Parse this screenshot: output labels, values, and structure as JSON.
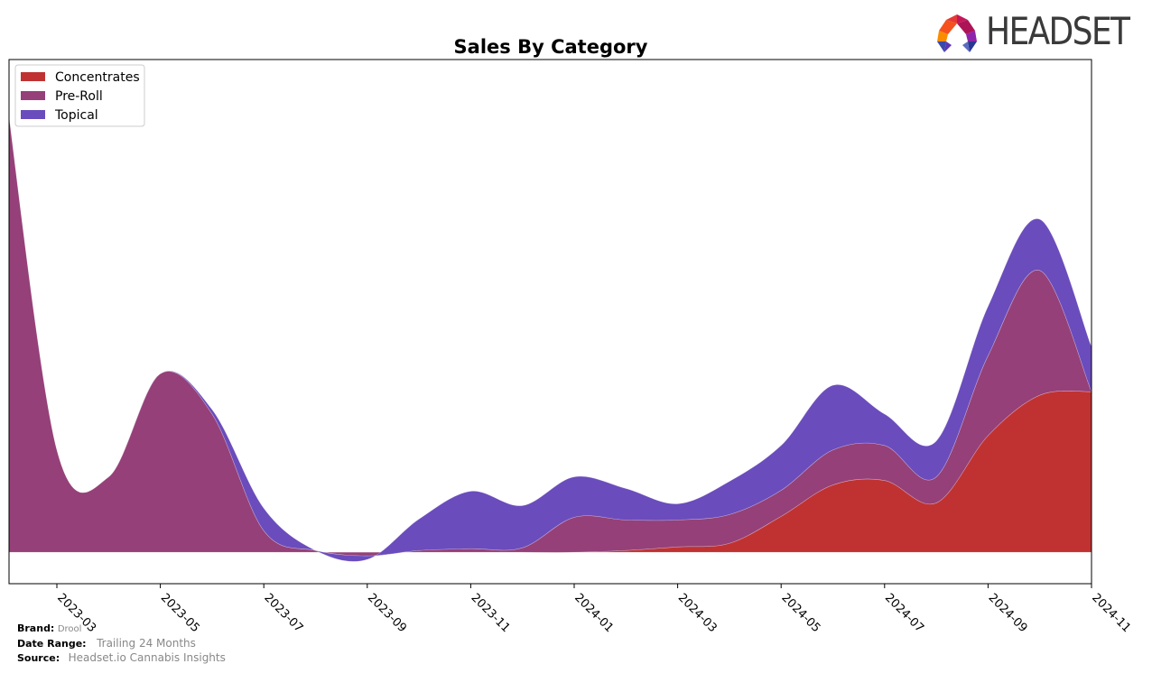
{
  "brand_logo": {
    "text": "HEADSET"
  },
  "footer": {
    "brand_label": "Brand:",
    "brand_value": "Drool",
    "date_range_label": "Date Range:",
    "date_range_value": "Trailing 24 Months",
    "source_label": "Source:",
    "source_value": "Headset.io Cannabis Insights"
  },
  "chart_data": {
    "type": "area",
    "stacked": true,
    "smooth": true,
    "title": "Sales By Category",
    "xlabel": "",
    "ylabel": "",
    "grid": false,
    "legend_position": "top-left",
    "x": [
      "2023-02",
      "2023-03",
      "2023-04",
      "2023-05",
      "2023-06",
      "2023-07",
      "2023-08",
      "2023-09",
      "2023-10",
      "2023-11",
      "2023-12",
      "2024-01",
      "2024-02",
      "2024-03",
      "2024-04",
      "2024-05",
      "2024-06",
      "2024-07",
      "2024-08",
      "2024-09",
      "2024-10",
      "2024-11"
    ],
    "x_tick_labels": [
      "2023-03",
      "2023-05",
      "2023-07",
      "2023-09",
      "2023-11",
      "2024-01",
      "2024-03",
      "2024-05",
      "2024-07",
      "2024-09",
      "2024-11"
    ],
    "ylim": [
      -35,
      549
    ],
    "series": [
      {
        "name": "Concentrates",
        "color": "#c03232",
        "values": [
          0,
          0,
          0,
          0,
          0,
          0,
          0,
          0,
          0,
          0,
          0,
          0,
          2,
          6,
          10,
          40,
          75,
          80,
          55,
          130,
          175,
          179
        ]
      },
      {
        "name": "Pre-Roll",
        "color": "#954078",
        "values": [
          519,
          114,
          84,
          199,
          154,
          24,
          2,
          -4,
          2,
          4,
          5,
          39,
          34,
          30,
          32,
          29,
          39,
          39,
          29,
          89,
          139,
          0
        ]
      },
      {
        "name": "Topical",
        "color": "#6a4cbc",
        "values": [
          0,
          0,
          0,
          0,
          5,
          25,
          0,
          -4,
          35,
          64,
          47,
          45,
          35,
          18,
          37,
          50,
          72,
          35,
          40,
          55,
          57,
          50
        ]
      }
    ]
  }
}
